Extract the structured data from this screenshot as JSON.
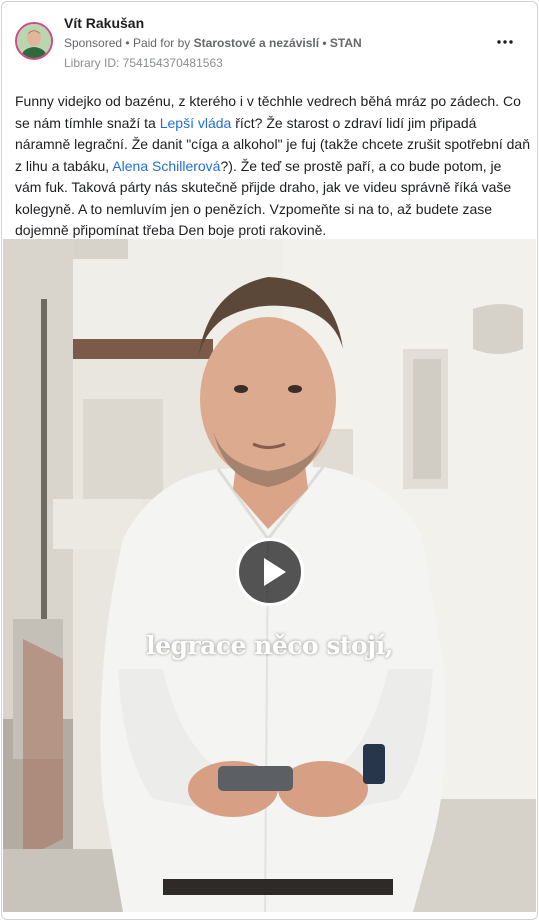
{
  "post": {
    "author": "Vít Rakušan",
    "sponsored": "Sponsored",
    "paid_prefix": "Paid for by",
    "payer": "Starostové a nezávislí • STAN",
    "library_id": "Library ID: 754154370481563"
  },
  "body": {
    "part1": "Funny videjko od bazénu, z kterého i v těchhle vedrech běhá mráz po zádech. Co se nám tímhle snaží ta ",
    "link1": "Lepší vláda",
    "part2": " říct? Že starost o zdraví lidí jim připadá náramně legrační. Že danit \"cíga a alkohol\" je fuj (takže chcete zrušit spotřební daň z lihu a tabáku, ",
    "link2": "Alena Schillerová",
    "part3": "?). Že teď se prostě paří, a co bude potom, je vám fuk. Taková párty nás skutečně přijde draho, jak ve videu správně říká vaše kolegyně. A to nemluvím jen o penězích. Vzpomeňte si na to, až budete zase dojemně připomínat třeba Den boje proti rakovině."
  },
  "video": {
    "subtitle": "legrace něco stojí,"
  },
  "icons": {
    "more": "more-options-icon",
    "play": "play-icon"
  },
  "colors": {
    "link": "#216fdb",
    "avatar_ring": "#d04a8a",
    "muted_text": "#65676b"
  }
}
